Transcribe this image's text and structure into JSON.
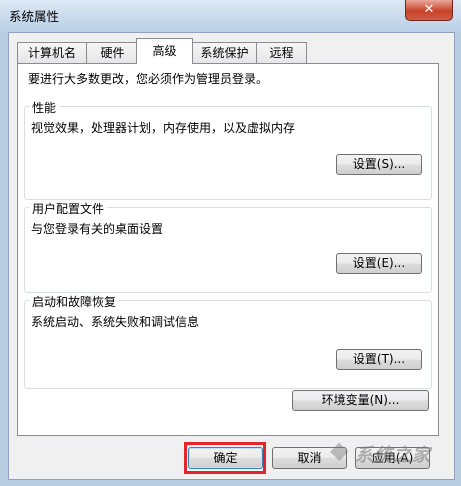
{
  "window": {
    "title": "系统属性",
    "close_label": "✕"
  },
  "tabs": [
    {
      "label": "计算机名",
      "active": false
    },
    {
      "label": "硬件",
      "active": false
    },
    {
      "label": "高级",
      "active": true
    },
    {
      "label": "系统保护",
      "active": false
    },
    {
      "label": "远程",
      "active": false
    }
  ],
  "advanced": {
    "notice": "要进行大多数更改，您必须作为管理员登录。",
    "performance": {
      "title": "性能",
      "description": "视觉效果，处理器计划，内存使用，以及虚拟内存",
      "button": "设置(S)..."
    },
    "user_profiles": {
      "title": "用户配置文件",
      "description": "与您登录有关的桌面设置",
      "button": "设置(E)..."
    },
    "startup_recovery": {
      "title": "启动和故障恢复",
      "description": "系统启动、系统失败和调试信息",
      "button": "设置(T)..."
    },
    "env_button": "环境变量(N)..."
  },
  "footer": {
    "ok": "确定",
    "cancel": "取消",
    "apply": "应用(A)"
  },
  "watermark": "系统之家",
  "colors": {
    "highlight": "#e0262c",
    "close": "#c7432b"
  }
}
